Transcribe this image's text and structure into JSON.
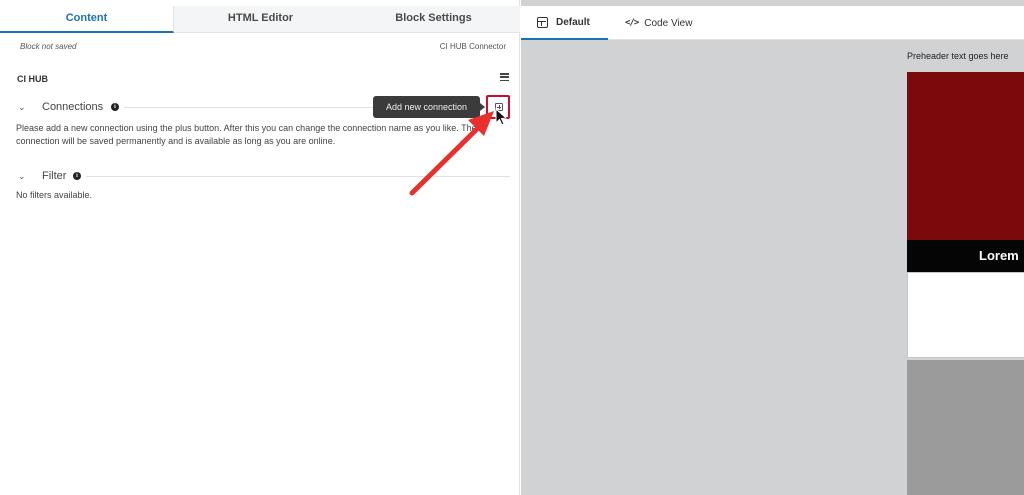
{
  "editor": {
    "tabs": [
      {
        "label": "Content",
        "active": true
      },
      {
        "label": "HTML Editor",
        "active": false
      },
      {
        "label": "Block Settings",
        "active": false
      }
    ],
    "status": "Block not saved",
    "connector_name": "CI HUB Connector",
    "section_title": "CI HUB",
    "connections": {
      "label": "Connections",
      "description": "Please add a new connection using the plus button. After this you can change the connection name as you like. The connection will be saved permanently and is available as long as you are online.",
      "tooltip": "Add new connection"
    },
    "filter": {
      "label": "Filter",
      "empty_text": "No filters available."
    }
  },
  "preview": {
    "view_tabs": [
      {
        "label": "Default",
        "active": true
      },
      {
        "label": "Code View",
        "active": false
      }
    ],
    "preheader": "Preheader text goes here",
    "banner_text": "Lorem"
  },
  "colors": {
    "accent": "#1a73b8",
    "highlight": "#c8102e",
    "hero": "#7c090c",
    "arrow": "#e8302d"
  }
}
